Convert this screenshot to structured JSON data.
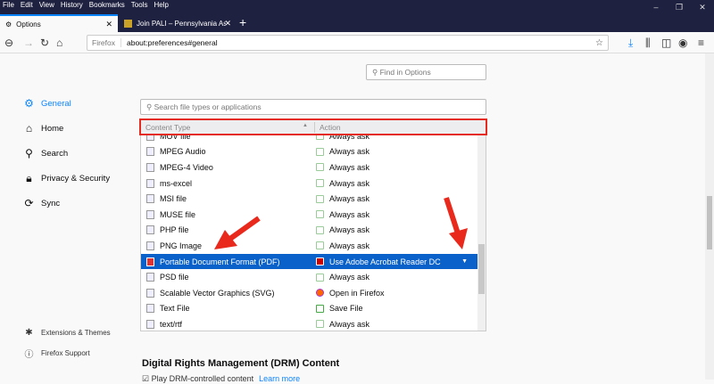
{
  "menu": [
    "File",
    "Edit",
    "View",
    "History",
    "Bookmarks",
    "Tools",
    "Help"
  ],
  "tabs": [
    {
      "label": "Options"
    },
    {
      "label": "Join PALI – Pennsylvania Asso"
    }
  ],
  "url": {
    "identity": "Firefox",
    "value": "about:preferences#general"
  },
  "find_placeholder": "Find in Options",
  "sidebar": {
    "items": [
      {
        "label": "General",
        "icon": "gear-icon"
      },
      {
        "label": "Home",
        "icon": "home-icon"
      },
      {
        "label": "Search",
        "icon": "search-icon"
      },
      {
        "label": "Privacy & Security",
        "icon": "lock-icon"
      },
      {
        "label": "Sync",
        "icon": "sync-icon"
      }
    ],
    "footer": [
      {
        "label": "Extensions & Themes",
        "icon": "puzzle-icon"
      },
      {
        "label": "Firefox Support",
        "icon": "help-icon"
      }
    ]
  },
  "applications": {
    "search_placeholder": "Search file types or applications",
    "col_type": "Content Type",
    "col_action": "Action",
    "rows": [
      {
        "type": "MOV file",
        "action": "Always ask"
      },
      {
        "type": "MPEG Audio",
        "action": "Always ask"
      },
      {
        "type": "MPEG-4 Video",
        "action": "Always ask"
      },
      {
        "type": "ms-excel",
        "action": "Always ask"
      },
      {
        "type": "MSI file",
        "action": "Always ask"
      },
      {
        "type": "MUSE file",
        "action": "Always ask"
      },
      {
        "type": "PHP file",
        "action": "Always ask"
      },
      {
        "type": "PNG Image",
        "action": "Always ask"
      },
      {
        "type": "Portable Document Format (PDF)",
        "action": "Use Adobe Acrobat Reader DC",
        "selected": true
      },
      {
        "type": "PSD file",
        "action": "Always ask"
      },
      {
        "type": "Scalable Vector Graphics (SVG)",
        "action": "Open in Firefox"
      },
      {
        "type": "Text File",
        "action": "Save File"
      },
      {
        "type": "text/rtf",
        "action": "Always ask"
      }
    ]
  },
  "drm": {
    "title": "Digital Rights Management (DRM) Content",
    "checkbox": "Play DRM-controlled content",
    "link": "Learn more"
  },
  "colors": {
    "accent": "#0a84ff",
    "selected": "#0a61c9",
    "highlight": "#e52b20",
    "chrome": "#1f2140"
  }
}
